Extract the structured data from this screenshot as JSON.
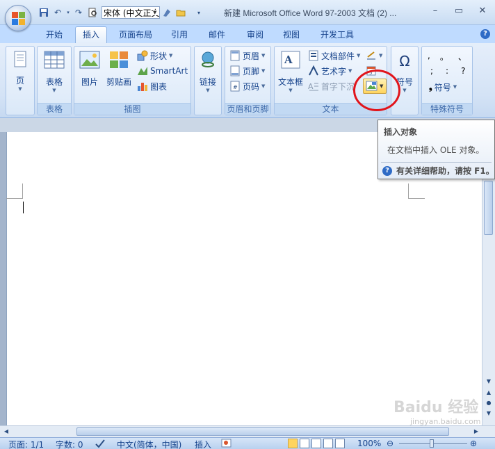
{
  "titlebar": {
    "font_name": "宋体 (中文正文",
    "doc_title": "新建 Microsoft Office Word 97-2003 文档 (2) ...",
    "minimize": "–",
    "restore": "▭",
    "close": "✕"
  },
  "tabs": [
    "开始",
    "插入",
    "页面布局",
    "引用",
    "邮件",
    "审阅",
    "视图",
    "开发工具"
  ],
  "active_tab": "插入",
  "ribbon": {
    "pages": {
      "page_label": "页"
    },
    "table": {
      "table_label": "表格",
      "group": "表格"
    },
    "illustrations": {
      "picture": "图片",
      "clipart": "剪贴画",
      "shapes": "形状",
      "smartart": "SmartArt",
      "chart": "图表",
      "group": "插图"
    },
    "links": {
      "link": "链接"
    },
    "header_footer": {
      "header": "页眉",
      "footer": "页脚",
      "page_number": "页码",
      "group": "页眉和页脚"
    },
    "text": {
      "textbox": "文本框",
      "quickparts": "文档部件",
      "wordart": "艺术字",
      "dropcap": "首字下沉",
      "group": "文本"
    },
    "symbols": {
      "symbol": "符号"
    },
    "special_symbols": {
      "row1": [
        ",",
        "。",
        "、"
      ],
      "row2": [
        ";",
        ":",
        "?"
      ],
      "more": "符号",
      "group": "特殊符号"
    }
  },
  "tooltip": {
    "title": "插入对象",
    "description": "在文档中插入 OLE 对象。",
    "help": "有关详细帮助，请按 F1。"
  },
  "statusbar": {
    "page": "页面: 1/1",
    "words": "字数: 0",
    "language": "中文(简体，中国)",
    "mode": "插入",
    "zoom": "100%"
  },
  "watermark": {
    "brand": "Baidu 经验",
    "url": "jingyan.baidu.com"
  }
}
